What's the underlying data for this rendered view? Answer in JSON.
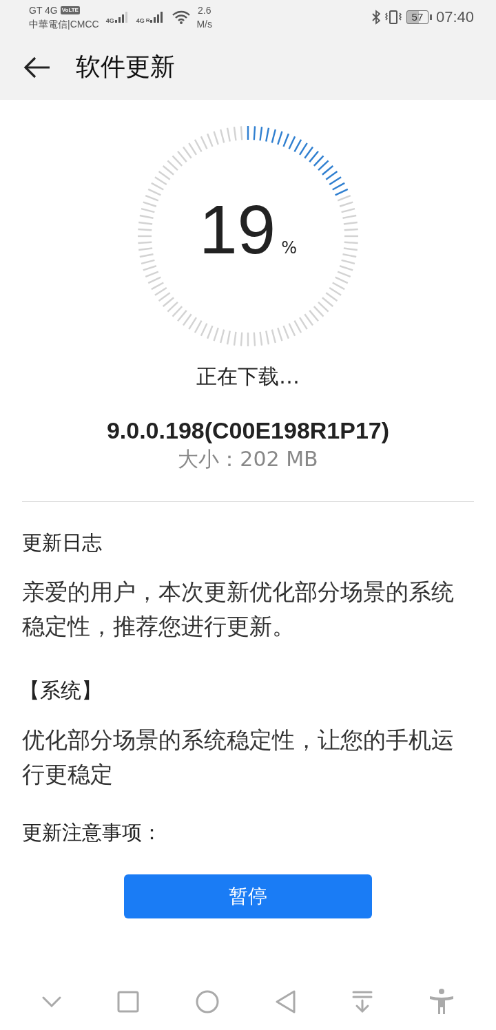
{
  "status_bar": {
    "network_type": "GT 4G",
    "volte_badge": "VoLTE",
    "carrier": "中華電信|CMCC",
    "sim1_label": "4G",
    "sim2_label": "4G",
    "sim2_roaming": "R",
    "speed_value": "2.6",
    "speed_unit": "M/s",
    "battery": "57",
    "time": "07:40"
  },
  "header": {
    "title": "软件更新"
  },
  "progress": {
    "value": "19",
    "unit": "%",
    "status": "正在下载…"
  },
  "package": {
    "version": "9.0.0.198(C00E198R1P17)",
    "size": "大小：202 MB"
  },
  "notes": [
    {
      "kind": "heading",
      "text": "更新日志"
    },
    {
      "kind": "paragraph",
      "text": "亲爱的用户，本次更新优化部分场景的系统稳定性，推荐您进行更新。"
    },
    {
      "kind": "section",
      "text": "【系统】"
    },
    {
      "kind": "paragraph",
      "text": "优化部分场景的系统稳定性，让您的手机运行更稳定"
    },
    {
      "kind": "heading",
      "text": "更新注意事项："
    }
  ],
  "action_button": {
    "label": "暂停"
  }
}
